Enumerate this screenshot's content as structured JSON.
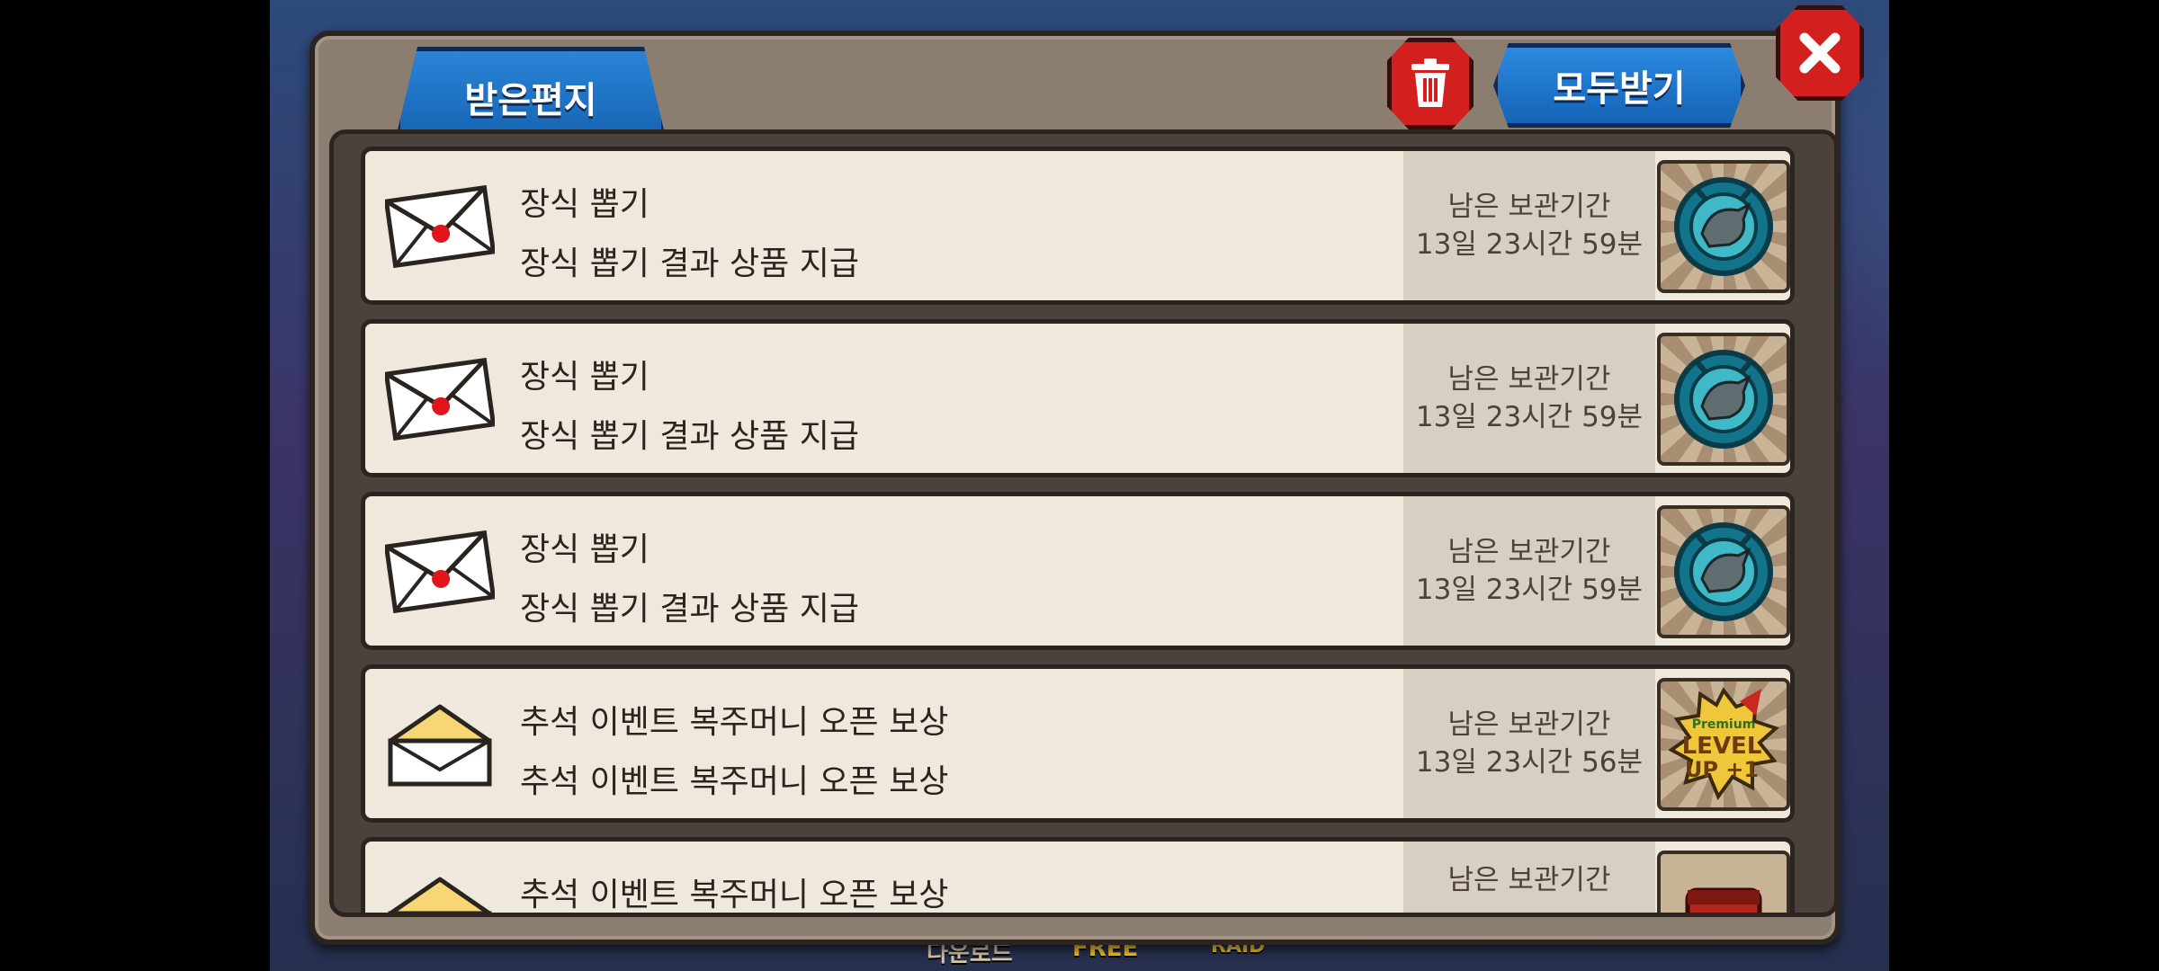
{
  "tab": {
    "label": "받은편지"
  },
  "buttons": {
    "receive_all": "모두받기"
  },
  "bottom_hud": {
    "item1": "다운로드",
    "item2": "FREE",
    "item3": "RAID"
  },
  "mails": [
    {
      "title": "장식 뽑기",
      "subtitle": "장식 뽑기 결과 상품 지급",
      "expiry_label": "남은 보관기간",
      "expiry_time": "13일 23시간 59분",
      "envelope": "sealed-envelope-icon",
      "reward": "dragon-emblem-icon"
    },
    {
      "title": "장식 뽑기",
      "subtitle": "장식 뽑기 결과 상품 지급",
      "expiry_label": "남은 보관기간",
      "expiry_time": "13일 23시간 59분",
      "envelope": "sealed-envelope-icon",
      "reward": "dragon-emblem-icon"
    },
    {
      "title": "장식 뽑기",
      "subtitle": "장식 뽑기 결과 상품 지급",
      "expiry_label": "남은 보관기간",
      "expiry_time": "13일 23시간 59분",
      "envelope": "sealed-envelope-icon",
      "reward": "dragon-emblem-icon"
    },
    {
      "title": "추석 이벤트 복주머니 오픈 보상",
      "subtitle": "추석 이벤트 복주머니 오픈 보상",
      "expiry_label": "남은 보관기간",
      "expiry_time": "13일 23시간 56분",
      "envelope": "open-envelope-icon",
      "reward": "level-up-plus-one-icon",
      "reward_text": {
        "top": "Premium",
        "line1": "LEVEL",
        "line2": "UP +1"
      }
    },
    {
      "title": "추석 이벤트 복주머니 오픈 보상",
      "subtitle": "",
      "expiry_label": "남은 보관기간",
      "expiry_time": "",
      "envelope": "open-envelope-icon",
      "reward": "treasure-chest-icon"
    }
  ],
  "colors": {
    "accent_blue": "#1b6cc0",
    "danger_red": "#d3201e",
    "frame_brown": "#8b7d70",
    "row_bg": "#efe8dc"
  }
}
